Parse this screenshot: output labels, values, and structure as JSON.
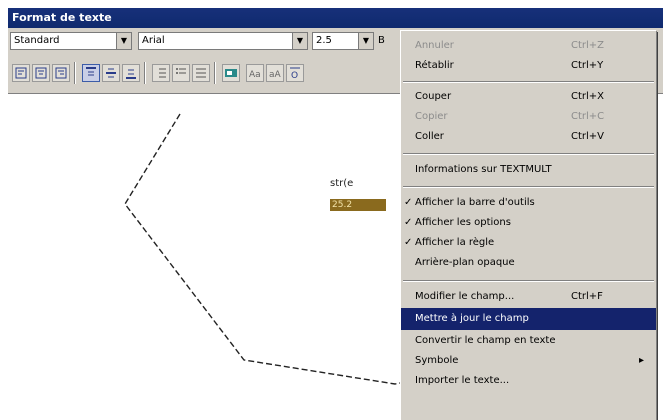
{
  "window": {
    "title": "Format de texte"
  },
  "toolbar": {
    "style_value": "Standard",
    "font_value": "Arial",
    "height_value": "2.5",
    "extra_label": "B"
  },
  "canvas": {
    "text_label": "str(e",
    "selected_text": "25.2"
  },
  "context_menu": {
    "items": [
      {
        "label": "Annuler",
        "shortcut": "Ctrl+Z",
        "disabled": true
      },
      {
        "label": "Rétablir",
        "shortcut": "Ctrl+Y",
        "disabled": false
      },
      {
        "label": "Couper",
        "shortcut": "Ctrl+X",
        "disabled": false
      },
      {
        "label": "Copier",
        "shortcut": "Ctrl+C",
        "disabled": true
      },
      {
        "label": "Coller",
        "shortcut": "Ctrl+V",
        "disabled": false
      },
      {
        "label": "Informations sur TEXTMULT",
        "shortcut": "",
        "disabled": false
      },
      {
        "label": "Afficher la barre d'outils",
        "shortcut": "",
        "checked": true
      },
      {
        "label": "Afficher les options",
        "shortcut": "",
        "checked": true
      },
      {
        "label": "Afficher la règle",
        "shortcut": "",
        "checked": true
      },
      {
        "label": "Arrière-plan opaque",
        "shortcut": "",
        "checked": false
      },
      {
        "label": "Modifier le champ...",
        "shortcut": "Ctrl+F",
        "disabled": false
      },
      {
        "label": "Mettre à jour le champ",
        "shortcut": "",
        "highlighted": true
      },
      {
        "label": "Convertir le champ en texte",
        "shortcut": "",
        "disabled": false
      },
      {
        "label": "Symbole",
        "shortcut": "",
        "submenu": true
      },
      {
        "label": "Importer le texte...",
        "shortcut": ""
      }
    ]
  }
}
